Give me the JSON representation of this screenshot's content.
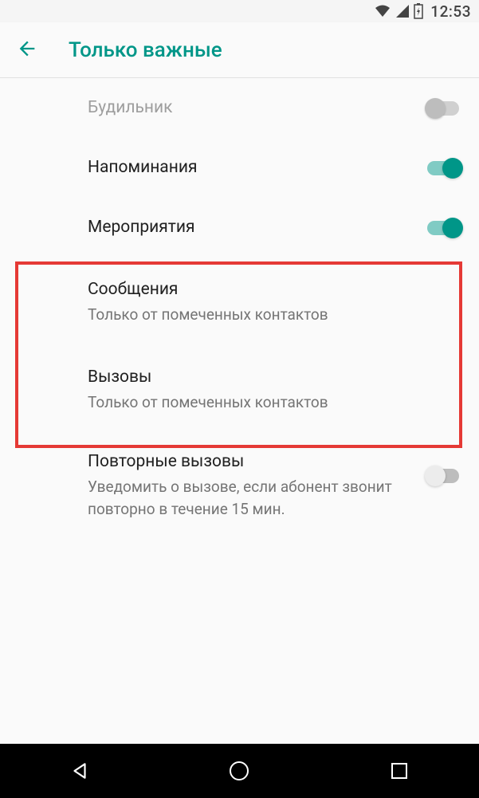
{
  "status_bar": {
    "time": "12:53"
  },
  "header": {
    "title": "Только важные"
  },
  "settings": {
    "alarm": {
      "title": "Будильник"
    },
    "reminders": {
      "title": "Напоминания"
    },
    "events": {
      "title": "Мероприятия"
    },
    "messages": {
      "title": "Сообщения",
      "subtitle": "Только от помеченных контактов"
    },
    "calls": {
      "title": "Вызовы",
      "subtitle": "Только от помеченных контактов"
    },
    "repeat_calls": {
      "title": "Повторные вызовы",
      "subtitle": "Уведомить о вызове, если абонент звонит повторно в течение 15 мин."
    }
  }
}
